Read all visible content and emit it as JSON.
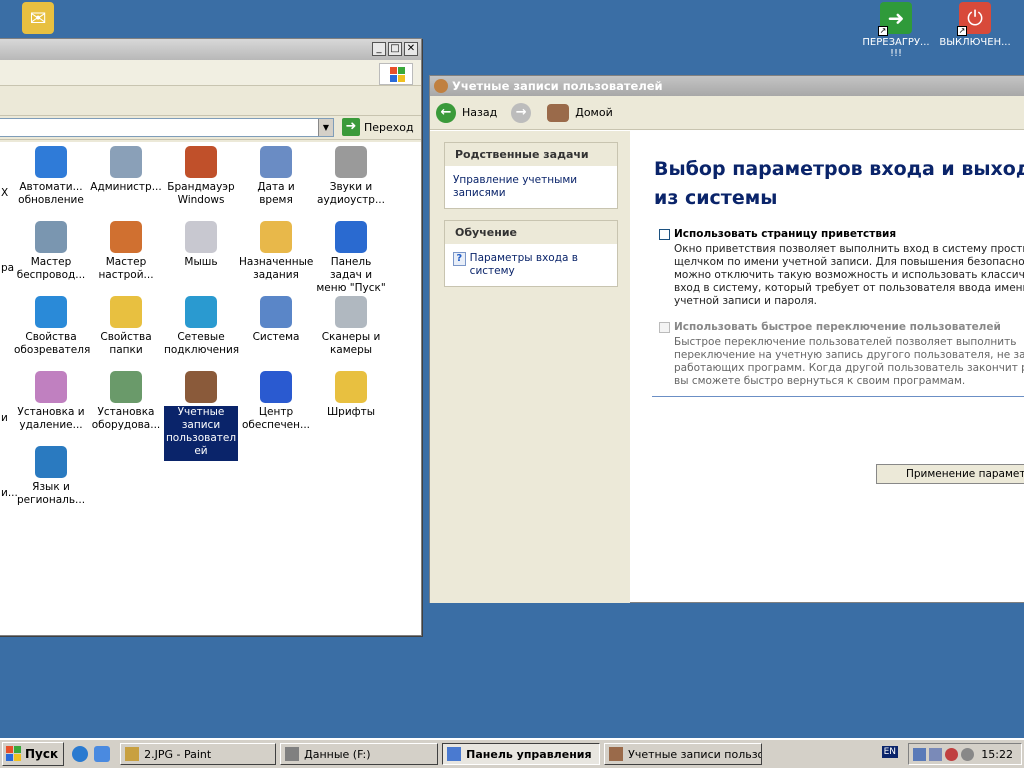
{
  "desktop": {
    "icons": [
      {
        "label": "ПЕРЕЗАГРУ... !!!"
      },
      {
        "label": "ВЫКЛЮЧЕН..."
      }
    ]
  },
  "control_panel": {
    "address_go": "Переход",
    "items": [
      {
        "label": "Автомати... обновление",
        "icon": "windows-update-icon",
        "color": "#2f7bd8"
      },
      {
        "label": "Администр...",
        "icon": "admin-tools-icon",
        "color": "#8aa0b8"
      },
      {
        "label": "Брандмауэр Windows",
        "icon": "firewall-icon",
        "color": "#c0502a"
      },
      {
        "label": "Дата и время",
        "icon": "clock-icon",
        "color": "#6a8cc4"
      },
      {
        "label": "Звуки и аудиоустр...",
        "icon": "speaker-icon",
        "color": "#9a9a9a"
      },
      {
        "label": "Мастер беспровод...",
        "icon": "wireless-icon",
        "color": "#7a96b0"
      },
      {
        "label": "Мастер настрой...",
        "icon": "network-home-icon",
        "color": "#d07030"
      },
      {
        "label": "Мышь",
        "icon": "mouse-icon",
        "color": "#c8c8d0"
      },
      {
        "label": "Назначенные задания",
        "icon": "scheduled-tasks-icon",
        "color": "#e8b84a"
      },
      {
        "label": "Панель задач и меню \"Пуск\"",
        "icon": "taskbar-icon",
        "color": "#2a6ad0"
      },
      {
        "label": "Свойства обозревателя",
        "icon": "internet-options-icon",
        "color": "#2a8ad8"
      },
      {
        "label": "Свойства папки",
        "icon": "folder-options-icon",
        "color": "#e8c040"
      },
      {
        "label": "Сетевые подключения",
        "icon": "network-connections-icon",
        "color": "#2a9ad0"
      },
      {
        "label": "Система",
        "icon": "system-icon",
        "color": "#5a86c8"
      },
      {
        "label": "Сканеры и камеры",
        "icon": "scanner-icon",
        "color": "#b0b8c0"
      },
      {
        "label": "Установка и удаление...",
        "icon": "add-remove-icon",
        "color": "#c080c0"
      },
      {
        "label": "Установка оборудова...",
        "icon": "add-hardware-icon",
        "color": "#6a9a6a"
      },
      {
        "label": "Учетные записи пользовател ей",
        "icon": "user-accounts-icon",
        "color": "#8a5a3a",
        "selected": true
      },
      {
        "label": "Центр обеспечен...",
        "icon": "security-center-icon",
        "color": "#2a5ad0"
      },
      {
        "label": "Шрифты",
        "icon": "fonts-icon",
        "color": "#e8c040"
      },
      {
        "label": "Язык и региональ...",
        "icon": "globe-icon",
        "color": "#2a7ac0"
      }
    ],
    "fragments": [
      "X",
      "ра",
      "и",
      "и..."
    ]
  },
  "user_accounts": {
    "title": "Учетные записи пользователей",
    "nav_back": "Назад",
    "nav_home": "Домой",
    "related_tasks_title": "Родственные задачи",
    "related_task_link": "Управление учетными записями",
    "learn_title": "Обучение",
    "learn_link": "Параметры входа в систему",
    "heading": "Выбор параметров входа и выхода из системы",
    "option1_title": "Использовать страницу приветствия",
    "option1_desc": "Окно приветствия позволяет выполнить вход в систему простым щелчком по имени учетной записи. Для повышения безопасности можно отключить такую возможность и использовать классический вход в систему, который требует от пользователя ввода имени учетной записи и пароля.",
    "option2_title": "Использовать быстрое переключение пользователей",
    "option2_desc": "Быстрое переключение пользователей позволяет выполнить переключение на учетную запись другого пользователя, не закрывая работающих программ. Когда другой пользователь закончит работу, вы сможете быстро вернуться к своим программам.",
    "apply_button": "Применение параметров"
  },
  "taskbar": {
    "start": "Пуск",
    "tasks": [
      {
        "label": "2.JPG - Paint",
        "active": false
      },
      {
        "label": "Данные (F:)",
        "active": false
      },
      {
        "label": "Панель управления",
        "active": true
      },
      {
        "label": "Учетные записи пользо...",
        "active": false
      }
    ],
    "lang": "EN",
    "time": "15:22"
  }
}
